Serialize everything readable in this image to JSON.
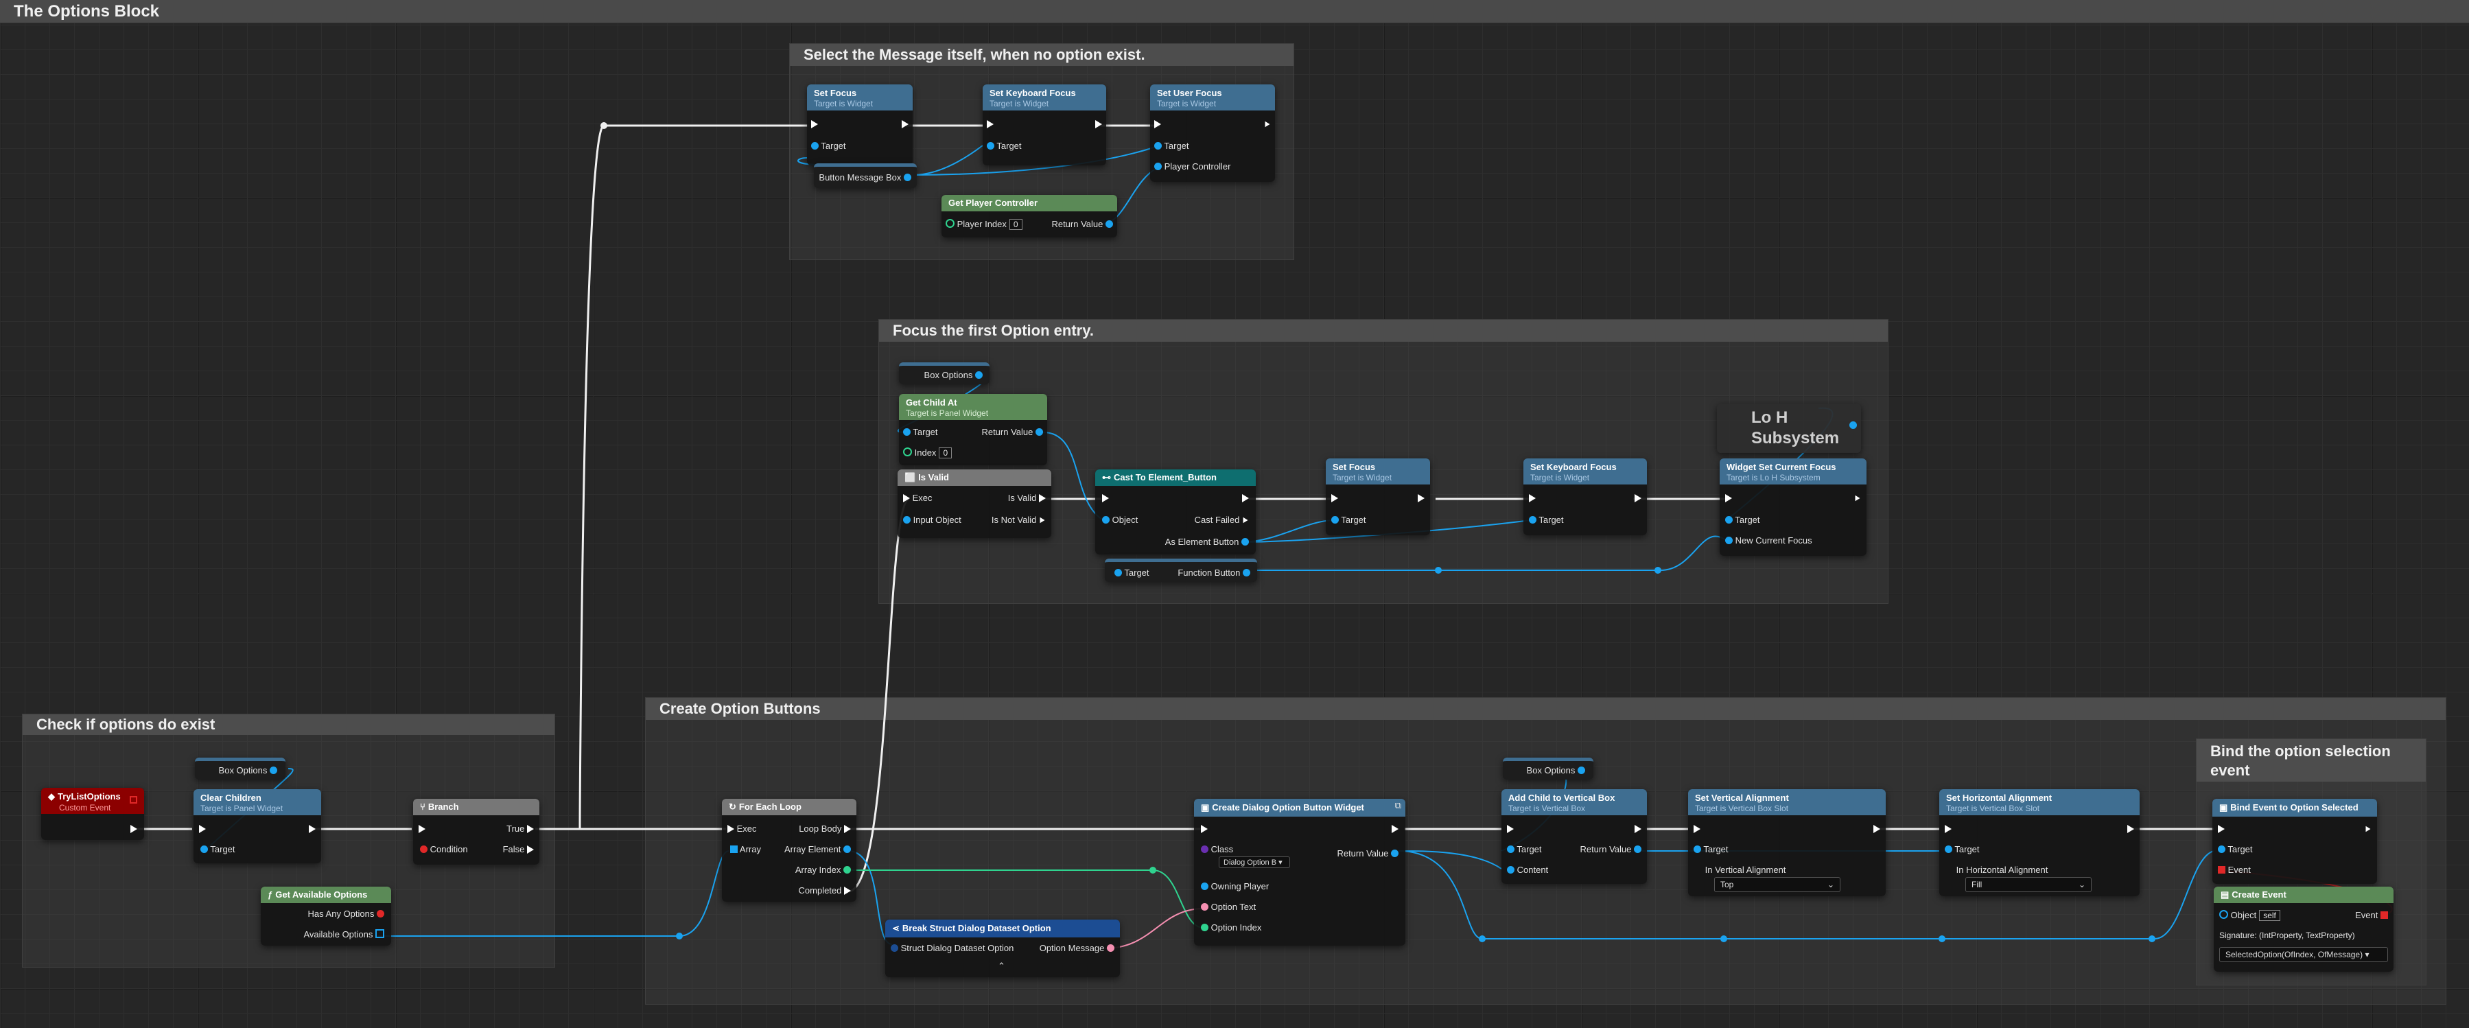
{
  "comments": {
    "options_block": "The Options Block",
    "select_message": "Select the Message itself, when no option exist.",
    "focus_first": "Focus the first Option entry.",
    "check_options": "Check if options do exist",
    "create_buttons": "Create Option Buttons",
    "bind_selection": "Bind the option selection event"
  },
  "sel": {
    "setfocus": {
      "title": "Set Focus",
      "sub": "Target is Widget",
      "target": "Target"
    },
    "kbfocus": {
      "title": "Set Keyboard Focus",
      "sub": "Target is Widget",
      "target": "Target"
    },
    "userfocus": {
      "title": "Set User Focus",
      "sub": "Target is Widget",
      "target": "Target",
      "pc": "Player Controller"
    },
    "msgbox": "Button Message Box",
    "getpc": {
      "title": "Get Player Controller",
      "index": "Player Index",
      "index_val": "0",
      "ret": "Return Value"
    }
  },
  "focus": {
    "boxopts": "Box Options",
    "getchild": {
      "title": "Get Child At",
      "sub": "Target is Panel Widget",
      "target": "Target",
      "ret": "Return Value",
      "index": "Index",
      "index_val": "0"
    },
    "isvalid": {
      "title": "Is Valid",
      "exec": "Exec",
      "valid": "Is Valid",
      "input": "Input Object",
      "notvalid": "Is Not Valid"
    },
    "cast": {
      "title": "Cast To Element_Button",
      "object": "Object",
      "failed": "Cast Failed",
      "as": "As Element Button"
    },
    "funcbtn": {
      "target": "Target",
      "out": "Function Button"
    },
    "setfocus": {
      "title": "Set Focus",
      "sub": "Target is Widget",
      "target": "Target"
    },
    "kbfocus": {
      "title": "Set Keyboard Focus",
      "sub": "Target is Widget",
      "target": "Target"
    },
    "subsystem": "Lo H Subsystem",
    "wscf": {
      "title": "Widget Set Current Focus",
      "sub": "Target is Lo H Subsystem",
      "target": "Target",
      "newfocus": "New Current Focus"
    }
  },
  "check": {
    "event": {
      "title": "TryListOptions",
      "sub": "Custom Event"
    },
    "boxopts": "Box Options",
    "clear": {
      "title": "Clear Children",
      "sub": "Target is Panel Widget",
      "target": "Target"
    },
    "branch": {
      "title": "Branch",
      "true": "True",
      "cond": "Condition",
      "false": "False"
    },
    "getavail": {
      "title": "Get Available Options",
      "has": "Has Any Options",
      "avail": "Available Options"
    }
  },
  "create": {
    "foreach": {
      "title": "For Each Loop",
      "exec": "Exec",
      "body": "Loop Body",
      "array": "Array",
      "elem": "Array Element",
      "index": "Array Index",
      "done": "Completed"
    },
    "brk": {
      "title": "Break Struct Dialog Dataset Option",
      "in": "Struct Dialog Dataset Option",
      "msg": "Option Message"
    },
    "createw": {
      "title": "Create Dialog Option Button Widget",
      "class": "Class",
      "class_val": "Dialog Option B",
      "ret": "Return Value",
      "owner": "Owning Player",
      "text": "Option Text",
      "idx": "Option Index"
    },
    "boxopts": "Box Options",
    "addchild": {
      "title": "Add Child to Vertical Box",
      "sub": "Target is Vertical Box",
      "target": "Target",
      "ret": "Return Value",
      "content": "Content"
    },
    "valign": {
      "title": "Set Vertical Alignment",
      "sub": "Target is Vertical Box Slot",
      "target": "Target",
      "in": "In Vertical Alignment",
      "val": "Top"
    },
    "halign": {
      "title": "Set Horizontal Alignment",
      "sub": "Target is Vertical Box Slot",
      "target": "Target",
      "in": "In Horizontal Alignment",
      "val": "Fill"
    }
  },
  "bind": {
    "bindev": {
      "title": "Bind Event to Option Selected",
      "target": "Target",
      "event": "Event"
    },
    "create": {
      "title": "Create Event",
      "object": "Object",
      "obj_val": "self",
      "event": "Event",
      "sig": "Signature: (IntProperty, TextProperty)",
      "func": "SelectedOption(OfIndex, OfMessage)"
    }
  },
  "colors": {
    "exec": "#ffffff",
    "object": "#1aa3f0",
    "int": "#2fd38f",
    "text": "#f58fb1",
    "delegate": "#e12828",
    "function_header": "#3f6e91",
    "pure_header": "#5b8a57",
    "event_header": "#8c0000",
    "cast_header": "#0e6e6f",
    "struct_header": "#1c4d93"
  }
}
